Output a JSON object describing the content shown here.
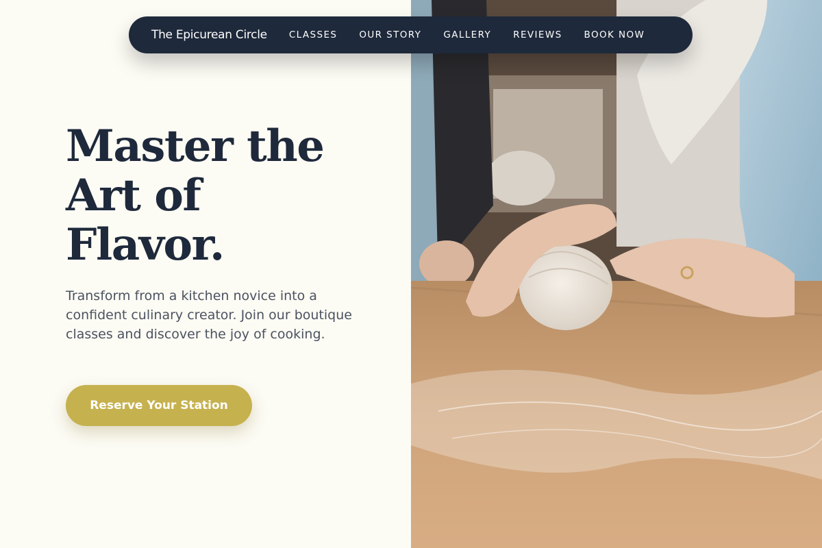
{
  "nav": {
    "brand": "The Epicurean Circle",
    "links": [
      "CLASSES",
      "OUR STORY",
      "GALLERY",
      "REVIEWS",
      "BOOK NOW"
    ]
  },
  "hero": {
    "title_lines": [
      "Master the",
      "Art of",
      "Flavor."
    ],
    "subtitle": "Transform from a kitchen novice into a confident culinary creator. Join our boutique classes and discover the joy of cooking.",
    "cta_label": "Reserve Your Station"
  },
  "colors": {
    "background": "#fcfbf4",
    "navy": "#1e293b",
    "accent_gold": "#c6b14f",
    "body_text": "#4b5260"
  },
  "icons": {
    "hero_image": "hands-kneading-dough-photo"
  }
}
